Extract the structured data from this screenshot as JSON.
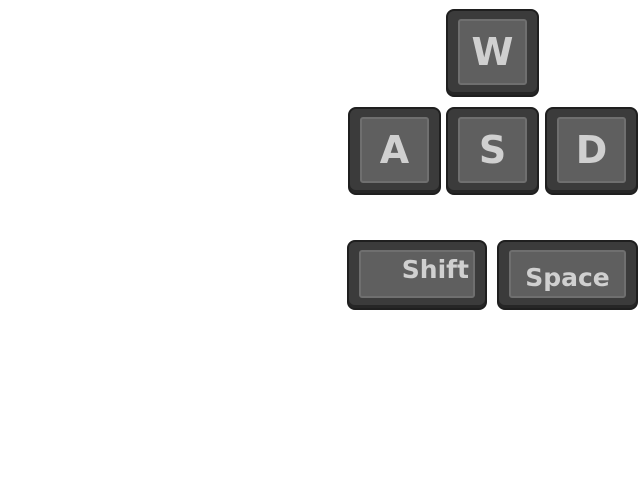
{
  "keys": {
    "w": "W",
    "a": "A",
    "s": "S",
    "d": "D",
    "shift": "Shift",
    "space": "Space"
  }
}
